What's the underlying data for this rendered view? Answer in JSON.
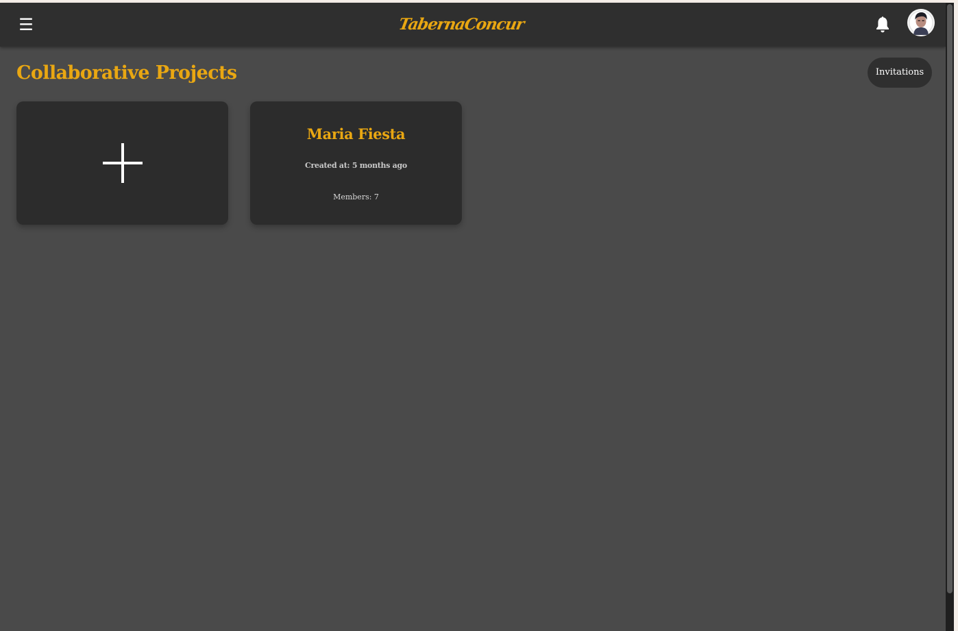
{
  "navbar": {
    "menu_glyph": "☰",
    "logo_text": "TabernaConcur",
    "bell_icon": "bell-icon",
    "avatar_alt": "User avatar"
  },
  "page": {
    "title": "Collaborative Projects",
    "invitations_label": "Invitations"
  },
  "cards": {
    "add_icon": "plus-icon",
    "project": {
      "name": "Maria Fiesta",
      "created": "Created at: 5 months ago",
      "members": "Members: 7"
    }
  },
  "colors": {
    "accent": "#e9a712",
    "navbar_bg": "#2f2f2f",
    "page_bg": "#4a4a4a",
    "card_bg": "#2c2c2c"
  }
}
